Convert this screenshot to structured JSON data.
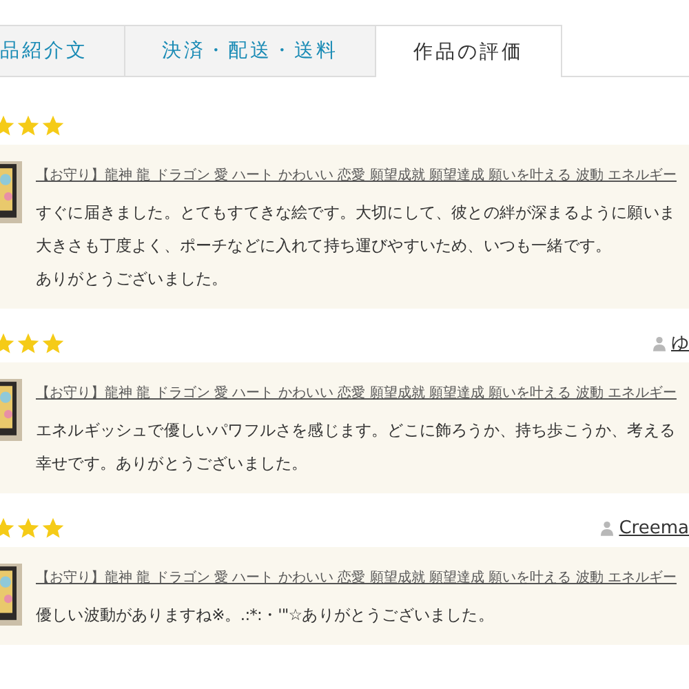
{
  "tabs": [
    {
      "label": "品紹介文",
      "selected": false
    },
    {
      "label": "決済・配送・送料",
      "selected": false
    },
    {
      "label": "作品の評価",
      "selected": true
    }
  ],
  "reviews": [
    {
      "stars": 3,
      "product": "【お守り】龍神 龍 ドラゴン 愛 ハート かわいい 恋愛 願望成就 願望達成 願いを叶える 波動 エネルギー",
      "lines": [
        "すぐに届きました。とてもすてきな絵です。大切にして、彼との絆が深まるように願いま",
        "大きさも丁度よく、ポーチなどに入れて持ち運びやすいため、いつも一緒です。",
        "ありがとうございました。"
      ]
    },
    {
      "stars": 3,
      "user": "ゆ",
      "product": "【お守り】龍神 龍 ドラゴン 愛 ハート かわいい 恋愛 願望成就 願望達成 願いを叶える 波動 エネルギー",
      "lines": [
        "エネルギッシュで優しいパワフルさを感じます。どこに飾ろうか、持ち歩こうか、考える",
        "幸せです。ありがとうございました。"
      ]
    },
    {
      "stars": 3,
      "user": "Creema",
      "product": "【お守り】龍神 龍 ドラゴン 愛 ハート かわいい 恋愛 願望成就 願望達成 願いを叶える 波動 エネルギー",
      "lines": [
        "優しい波動がありますね※。.:*:・'\"☆ありがとうございました。"
      ]
    }
  ]
}
